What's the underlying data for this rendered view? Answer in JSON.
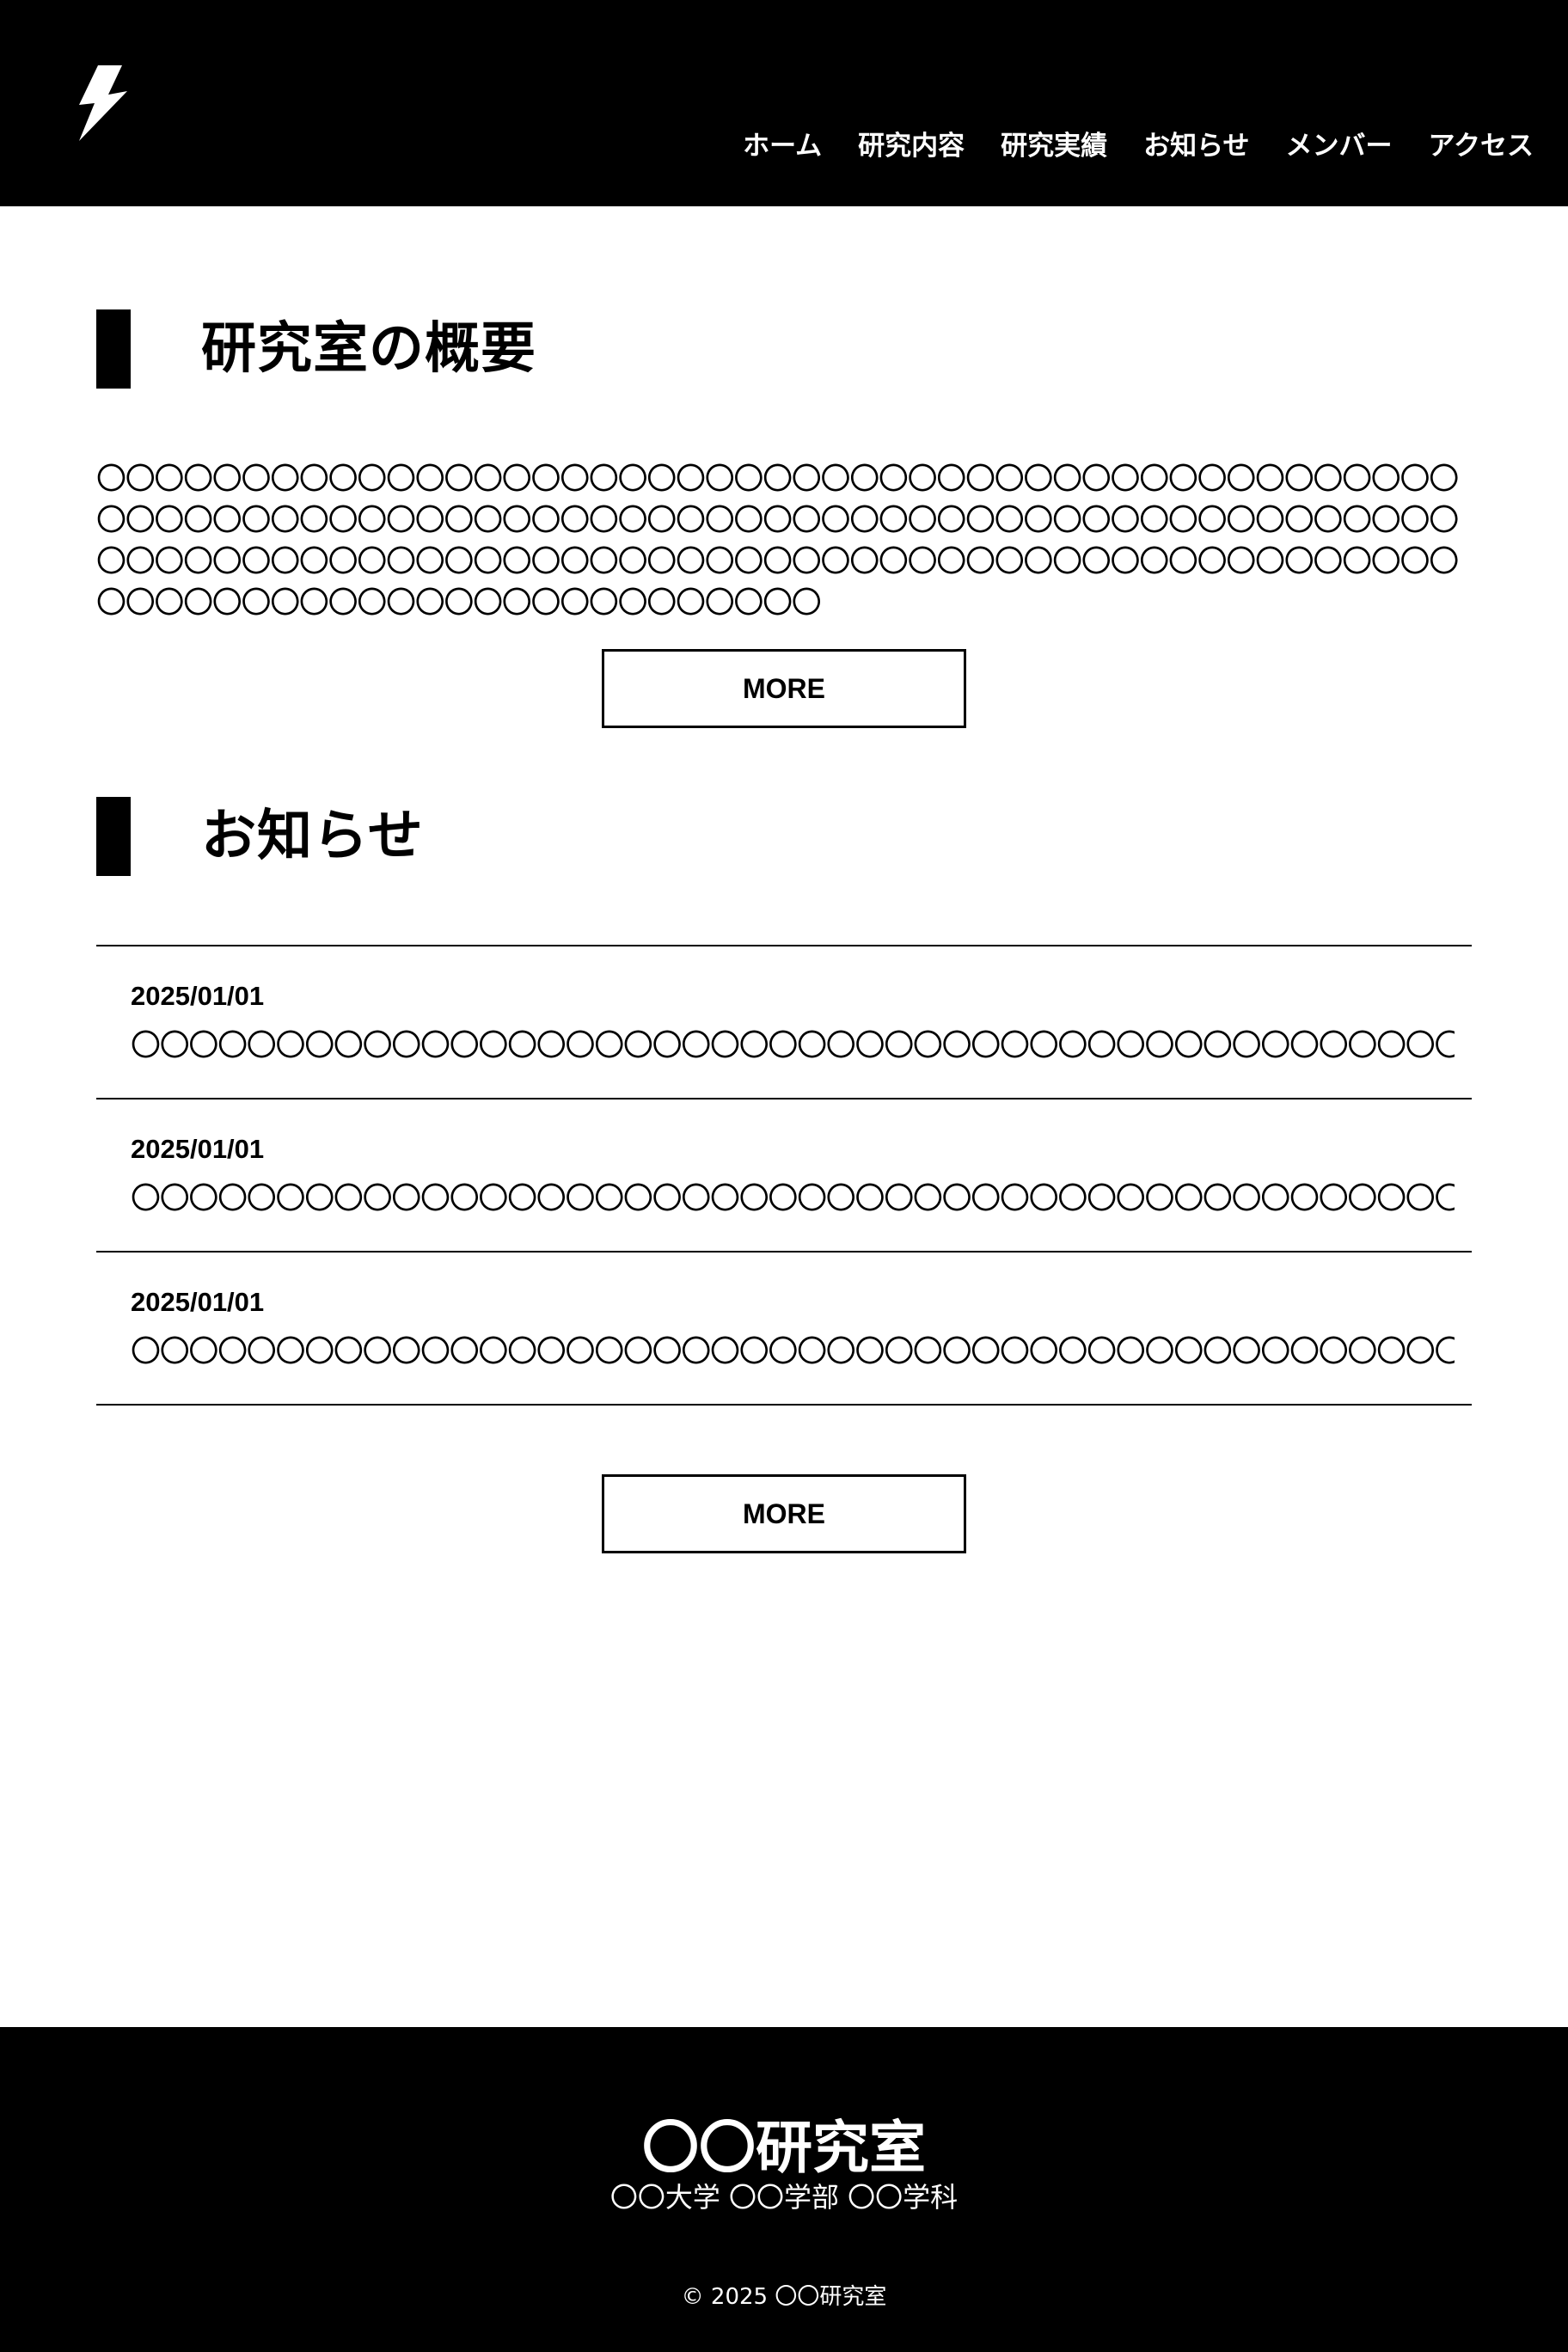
{
  "header": {
    "logo_icon": "lightning-bolt-icon",
    "nav": [
      {
        "label": "ホーム"
      },
      {
        "label": "研究内容"
      },
      {
        "label": "研究実績"
      },
      {
        "label": "お知らせ"
      },
      {
        "label": "メンバー"
      },
      {
        "label": "アクセス"
      }
    ]
  },
  "overview": {
    "title": "研究室の概要",
    "body": "〇〇〇〇〇〇〇〇〇〇〇〇〇〇〇〇〇〇〇〇〇〇〇〇〇〇〇〇〇〇〇〇〇〇〇〇〇〇〇〇〇〇〇〇〇〇〇〇〇〇〇〇〇〇〇〇〇〇〇〇〇〇〇〇〇〇〇〇〇〇〇〇〇〇〇〇〇〇〇〇〇〇〇〇〇〇〇〇〇〇〇〇〇〇〇〇〇〇〇〇〇〇〇〇〇〇〇〇〇〇〇〇〇〇〇〇〇〇〇〇〇〇〇〇〇〇〇〇〇〇〇〇〇〇〇〇〇〇〇〇〇〇〇〇〇〇〇〇〇〇〇〇〇〇〇〇〇〇〇〇〇〇〇〇〇〇",
    "more_label": "MORE"
  },
  "news": {
    "title": "お知らせ",
    "items": [
      {
        "date": "2025/01/01",
        "title": "〇〇〇〇〇〇〇〇〇〇〇〇〇〇〇〇〇〇〇〇〇〇〇〇〇〇〇〇〇〇〇〇〇〇〇〇〇〇〇〇〇〇〇〇〇〇〇"
      },
      {
        "date": "2025/01/01",
        "title": "〇〇〇〇〇〇〇〇〇〇〇〇〇〇〇〇〇〇〇〇〇〇〇〇〇〇〇〇〇〇〇〇〇〇〇〇〇〇〇〇〇〇〇〇〇〇〇"
      },
      {
        "date": "2025/01/01",
        "title": "〇〇〇〇〇〇〇〇〇〇〇〇〇〇〇〇〇〇〇〇〇〇〇〇〇〇〇〇〇〇〇〇〇〇〇〇〇〇〇〇〇〇〇〇〇〇〇"
      }
    ],
    "more_label": "MORE"
  },
  "footer": {
    "lab_name": "〇〇研究室",
    "affiliation": "〇〇大学 〇〇学部 〇〇学科",
    "copyright": "© 2025 〇〇研究室"
  },
  "colors": {
    "header_bg": "#000000",
    "footer_bg": "#000000",
    "text": "#000000",
    "inverse_text": "#ffffff"
  }
}
